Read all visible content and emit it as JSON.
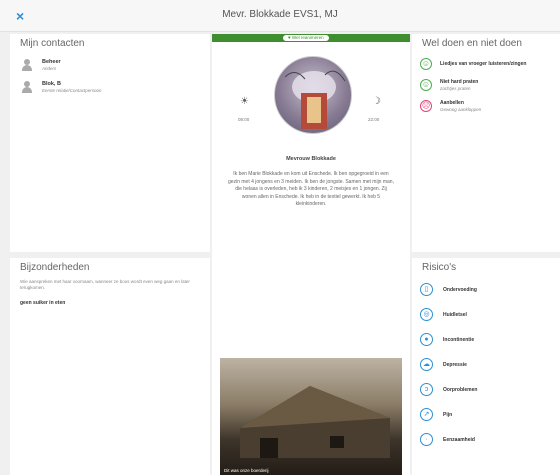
{
  "window": {
    "title": "Mevr. Blokkade EVS1, MJ",
    "close_label": "×"
  },
  "contacts": {
    "title": "Mijn contacten",
    "items": [
      {
        "name": "Beheer",
        "role": "Anders"
      },
      {
        "name": "Blok, B",
        "role": "Eerste relatie/Contactpersoon"
      }
    ]
  },
  "bijzonderheden": {
    "title": "Bijzonderheden",
    "note": "Wie aanspreken met haar voornaam, wanneer ze boos wordt even weg gaan en later terugkomen.",
    "item": "geen suiker in eten"
  },
  "profile": {
    "badge": "♥ Wel reanimeren",
    "time_morning": "08:00",
    "time_night": "22:00",
    "name": "Mevrouw Blokkade",
    "bio": "Ik ben Marie Blokkade en kom uit Enschede. Ik ben opgegroeid in een gezin met 4 jongens en 3 meiden. Ik ben de jongste. Samen met mijn man, die helaas is overleden, heb ik 3 kinderen, 2 meisjes en 1 jongen. Zij wonen allen in Enschede. Ik heb in de textiel gewerkt. Ik heb 5 kleinkinderen.",
    "photo_caption": "Dit was onze boerderij"
  },
  "weldoen": {
    "title": "Wel doen en niet doen",
    "items": [
      {
        "label": "Liedjes van vroeger luisteren/zingen",
        "sub": "",
        "mood": "positive",
        "icon": "smile-icon"
      },
      {
        "label": "Niet hard praten",
        "sub": "zachtjes praten",
        "mood": "positive",
        "icon": "smile-icon"
      },
      {
        "label": "Aanbellen",
        "sub": "Gewoog aankloppen",
        "mood": "negative",
        "icon": "frown-icon"
      }
    ]
  },
  "risicos": {
    "title": "Risico's",
    "items": [
      {
        "label": "Ondervoeding",
        "icon": "cup-icon",
        "glyph": "▯"
      },
      {
        "label": "Huidletsel",
        "icon": "target-icon",
        "glyph": "◎"
      },
      {
        "label": "Incontinentie",
        "icon": "drop-icon",
        "glyph": "●"
      },
      {
        "label": "Depressie",
        "icon": "cloud-icon",
        "glyph": "☁"
      },
      {
        "label": "Oorproblemen",
        "icon": "ear-icon",
        "glyph": "ↄ"
      },
      {
        "label": "Pijn",
        "icon": "bolt-icon",
        "glyph": "↗"
      },
      {
        "label": "Eenzaamheid",
        "icon": "dot-icon",
        "glyph": "·"
      }
    ]
  },
  "colors": {
    "accent": "#2a8fd6",
    "positive": "#4caf50",
    "negative": "#e0457b",
    "reanimate": "#3e8e2f"
  }
}
